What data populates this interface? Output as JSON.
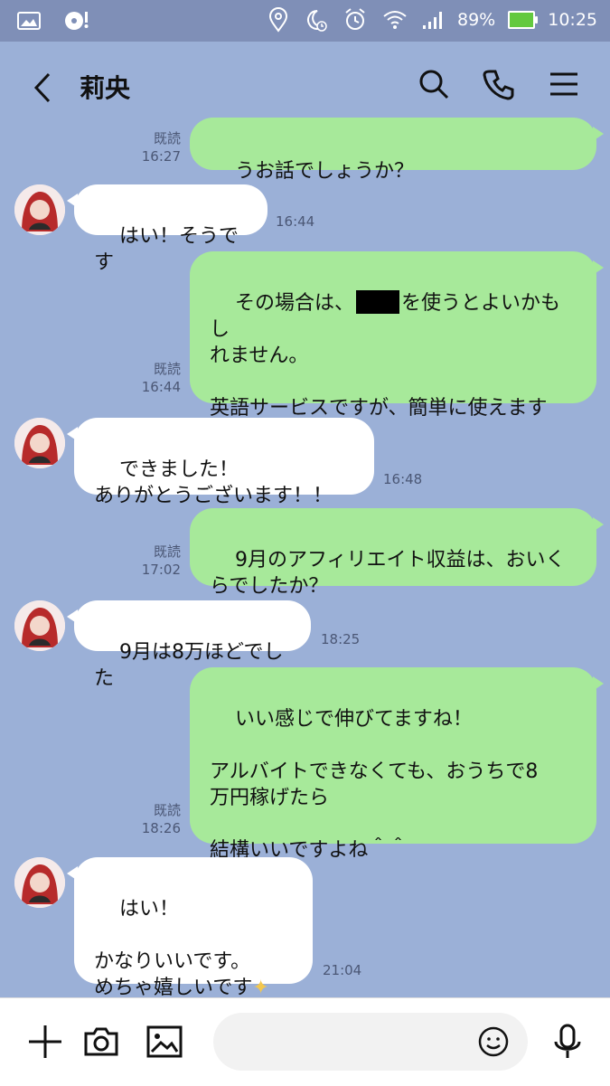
{
  "status_bar": {
    "battery": "89%",
    "time": "10:25"
  },
  "header": {
    "title": "莉央"
  },
  "messages": [
    {
      "side": "out",
      "text": "うお話でしょうか？",
      "read": "既読",
      "time": "16:27"
    },
    {
      "side": "in",
      "text": "はい！そうです",
      "time": "16:44"
    },
    {
      "side": "out",
      "text_before": "その場合は、",
      "text_after": "を使うとよいかもし\nれません。\n\n英語サービスですが、簡単に使えます\nよ。",
      "read": "既読",
      "time": "16:44"
    },
    {
      "side": "in",
      "text": "できました！\nありがとうございます！！",
      "time": "16:48"
    },
    {
      "side": "out",
      "text": "9月のアフィリエイト収益は、おいく\nらでしたか？",
      "read": "既読",
      "time": "17:02"
    },
    {
      "side": "in",
      "text": "9月は8万ほどでした",
      "time": "18:25"
    },
    {
      "side": "out",
      "text": "いい感じで伸びてますね！\n\nアルバイトできなくても、おうちで8\n万円稼げたら\n\n結構いいですよね＾＾",
      "read": "既読",
      "time": "18:26"
    },
    {
      "side": "in",
      "text": "はい！\n\nかなりいいです。\nめちゃ嬉しいです",
      "time": "21:04"
    }
  ],
  "composer": {
    "placeholder": ""
  },
  "icons": {
    "back": "chevron-left-icon",
    "search": "search-icon",
    "call": "phone-icon",
    "menu": "menu-icon",
    "add": "plus-icon",
    "camera": "camera-icon",
    "image": "image-icon",
    "emoji": "emoji-icon",
    "mic": "microphone-icon"
  },
  "colors": {
    "background": "#9bb0d7",
    "incoming": "#ffffff",
    "outgoing": "#a7e99a"
  }
}
